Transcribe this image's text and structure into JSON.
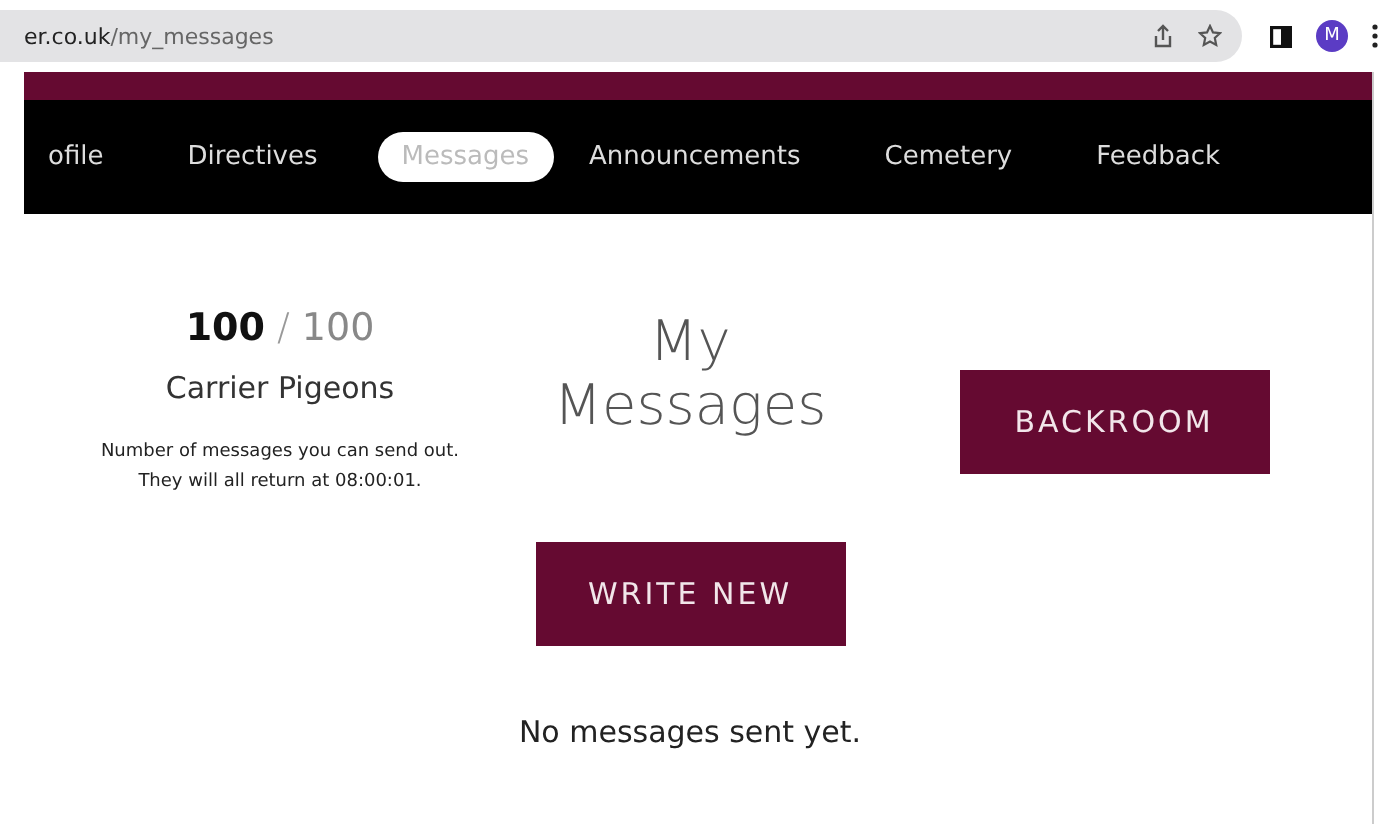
{
  "browser": {
    "url_host": "er.co.uk",
    "url_path": "/my_messages",
    "avatar": "M"
  },
  "nav": [
    {
      "label": "ofile",
      "selected": false
    },
    {
      "label": "Directives",
      "selected": false
    },
    {
      "label": "Messages",
      "selected": true
    },
    {
      "label": "Announcements",
      "selected": false
    },
    {
      "label": "Cemetery",
      "selected": false
    },
    {
      "label": "Feedback",
      "selected": false
    }
  ],
  "pigeons": {
    "current": "100",
    "separator": "/",
    "total": "100",
    "label": "Carrier Pigeons",
    "note_lines": [
      "Number of messages you can send out.",
      "They will all return at 08:00:01."
    ]
  },
  "title_lines": [
    "My",
    "Messages"
  ],
  "buttons": {
    "backroom": "BACKROOM",
    "write_new": "WRITE NEW"
  },
  "empty_message": "No messages sent yet."
}
